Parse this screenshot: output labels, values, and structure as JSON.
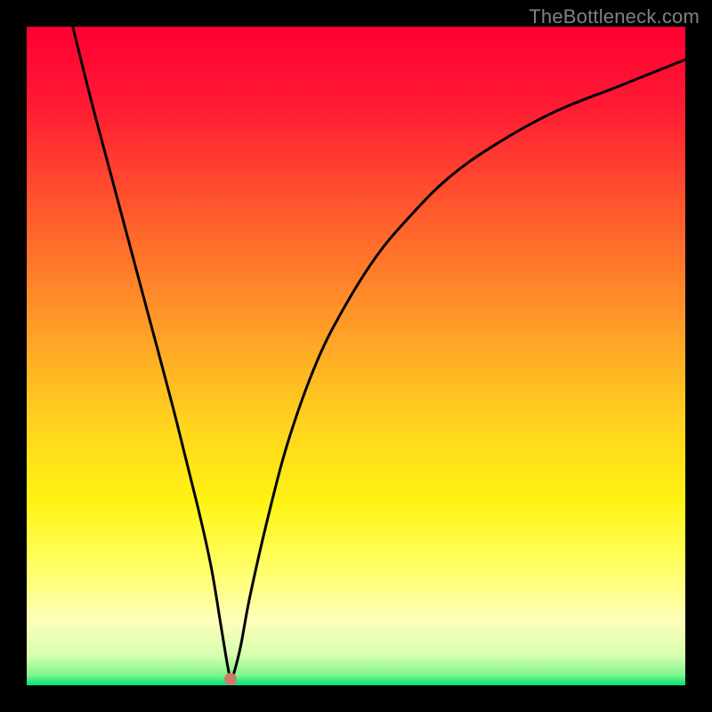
{
  "watermark": "TheBottleneck.com",
  "chart_data": {
    "type": "line",
    "title": "",
    "xlabel": "",
    "ylabel": "",
    "xlim": [
      0,
      100
    ],
    "ylim": [
      0,
      100
    ],
    "grid": false,
    "legend": false,
    "background": {
      "type": "vertical-gradient",
      "stops": [
        {
          "pos": 0.0,
          "color": "#ff0033"
        },
        {
          "pos": 0.12,
          "color": "#ff1a33"
        },
        {
          "pos": 0.28,
          "color": "#ff5a2d"
        },
        {
          "pos": 0.45,
          "color": "#ff9a28"
        },
        {
          "pos": 0.6,
          "color": "#ffd21e"
        },
        {
          "pos": 0.72,
          "color": "#fff312"
        },
        {
          "pos": 0.82,
          "color": "#ffff66"
        },
        {
          "pos": 0.9,
          "color": "#ffffb8"
        },
        {
          "pos": 0.955,
          "color": "#d6ffb0"
        },
        {
          "pos": 0.985,
          "color": "#7df58a"
        },
        {
          "pos": 1.0,
          "color": "#00e07a"
        }
      ]
    },
    "series": [
      {
        "name": "bottleneck-curve",
        "x": [
          7,
          10,
          14,
          18,
          22,
          26,
          28,
          29.5,
          30.5,
          31,
          31.5,
          32.5,
          34,
          37,
          40,
          44,
          48,
          53,
          58,
          64,
          71,
          80,
          90,
          100
        ],
        "y": [
          100,
          88,
          73,
          58,
          43,
          27,
          18,
          9,
          3,
          1,
          2,
          6,
          14,
          27,
          38,
          49,
          57,
          65,
          71,
          77,
          82,
          87,
          91,
          95
        ]
      }
    ],
    "marker": {
      "x": 31,
      "y": 1,
      "color": "#cd7a6b"
    }
  }
}
